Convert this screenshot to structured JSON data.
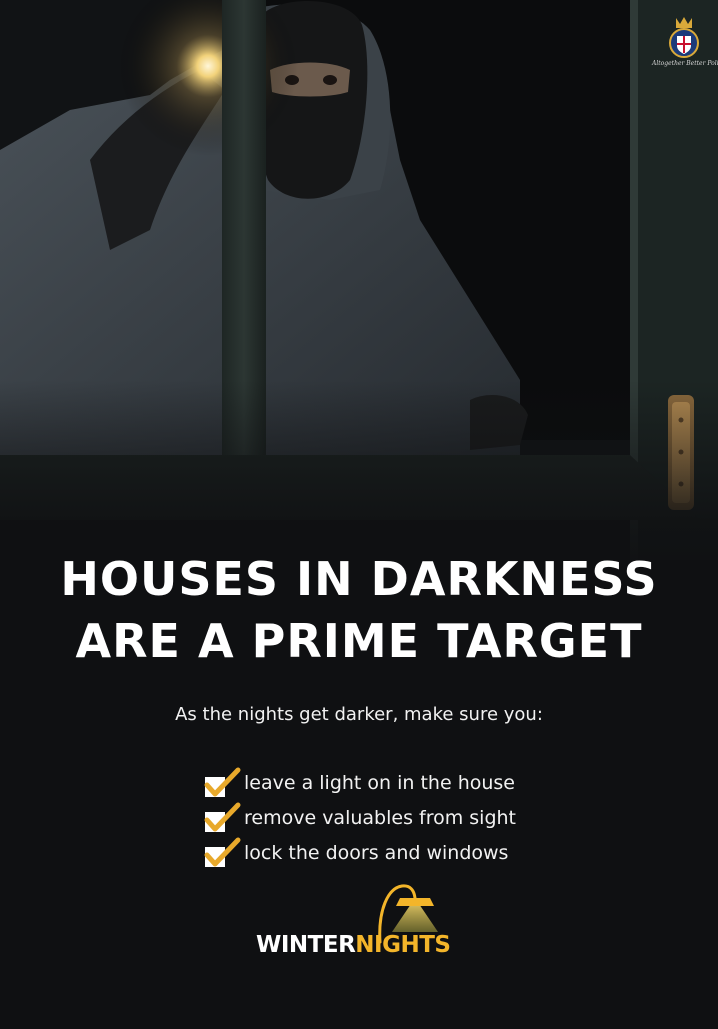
{
  "poster": {
    "headline_line1": "HOUSES IN DARKNESS",
    "headline_line2": "ARE A PRIME TARGET",
    "intro": "As the nights get darker, make sure you:",
    "checklist": [
      {
        "text": "leave a light on in the house"
      },
      {
        "text": "remove valuables from sight"
      },
      {
        "text": "lock the doors and windows"
      }
    ],
    "logo": {
      "word1": "WINTER",
      "word2": "NIGHTS"
    },
    "crest_motto": "Altogether Better Policing"
  },
  "colors": {
    "background": "#0f1012",
    "accent": "#f3b52a",
    "text": "#ffffff",
    "check": "#e8a92b"
  },
  "icons": {
    "checkbox": "checkmark-box-icon",
    "lamp": "desk-lamp-icon",
    "crest": "police-crest-icon"
  }
}
